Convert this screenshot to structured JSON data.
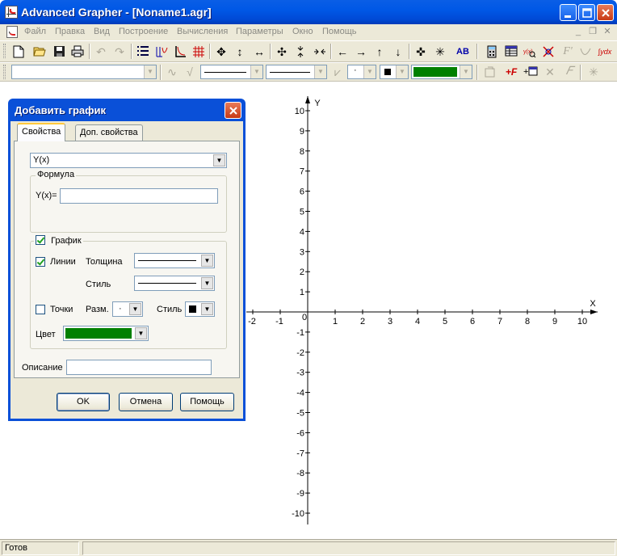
{
  "window": {
    "title": "Advanced Grapher - [Noname1.agr]"
  },
  "menu": {
    "items": [
      "Файл",
      "Правка",
      "Вид",
      "Построение",
      "Вычисления",
      "Параметры",
      "Окно",
      "Помощь"
    ],
    "mdi_controls": [
      "_",
      "❐",
      "✕"
    ]
  },
  "toolbar1": {
    "icons": [
      "new-icon",
      "open-icon",
      "save-icon",
      "print-icon",
      "undo-icon",
      "redo-icon",
      "graph-list-icon",
      "table-icon",
      "axes-icon",
      "grid-icon",
      "move-icon",
      "stretch-vertical-icon",
      "stretch-horizontal-icon",
      "zoom-in-icon",
      "compress-vertical-icon",
      "compress-horizontal-icon",
      "arrow-left-icon",
      "arrow-right-icon",
      "arrow-up-icon",
      "arrow-down-icon",
      "center-icon",
      "fit-icon",
      "label-icon",
      "calculator-icon",
      "table-values-icon",
      "analysis-icon",
      "intersection-icon",
      "derivative-icon",
      "tangent-icon",
      "integral-icon"
    ],
    "label_text": "AB",
    "derivative_text": "F'",
    "integral_text": "∫ydx"
  },
  "toolbar2": {
    "function_select": "",
    "color_swatch": "#008000",
    "point_marker": "·"
  },
  "graph": {
    "x_axis_label": "X",
    "y_axis_label": "Y",
    "origin_label": "0",
    "x_ticks": [
      -2,
      -1,
      1,
      2,
      3,
      4,
      5,
      6,
      7,
      8,
      9,
      10
    ],
    "y_ticks": [
      10,
      9,
      8,
      7,
      6,
      5,
      4,
      3,
      2,
      1,
      -1,
      -2,
      -3,
      -4,
      -5,
      -6,
      -7,
      -8,
      -9,
      -10
    ]
  },
  "dialog": {
    "title": "Добавить график",
    "tabs": [
      {
        "label": "Свойства",
        "active": true
      },
      {
        "label": "Доп. свойства",
        "active": false
      }
    ],
    "type_select": "Y(x)",
    "formula_group": "Формула",
    "formula_label": "Y(x)=",
    "formula_value": "",
    "graph_group": "График",
    "graph_checked": true,
    "lines_label": "Линии",
    "lines_checked": true,
    "thickness_label": "Толщина",
    "style_label": "Стиль",
    "points_label": "Точки",
    "points_checked": false,
    "size_label": "Разм.",
    "size_value": "·",
    "points_style_label": "Стиль",
    "color_label": "Цвет",
    "color_value": "#008000",
    "description_label": "Описание",
    "description_value": "",
    "ok_label": "OK",
    "cancel_label": "Отмена",
    "help_label": "Помощь"
  },
  "status": {
    "text": "Готов"
  }
}
